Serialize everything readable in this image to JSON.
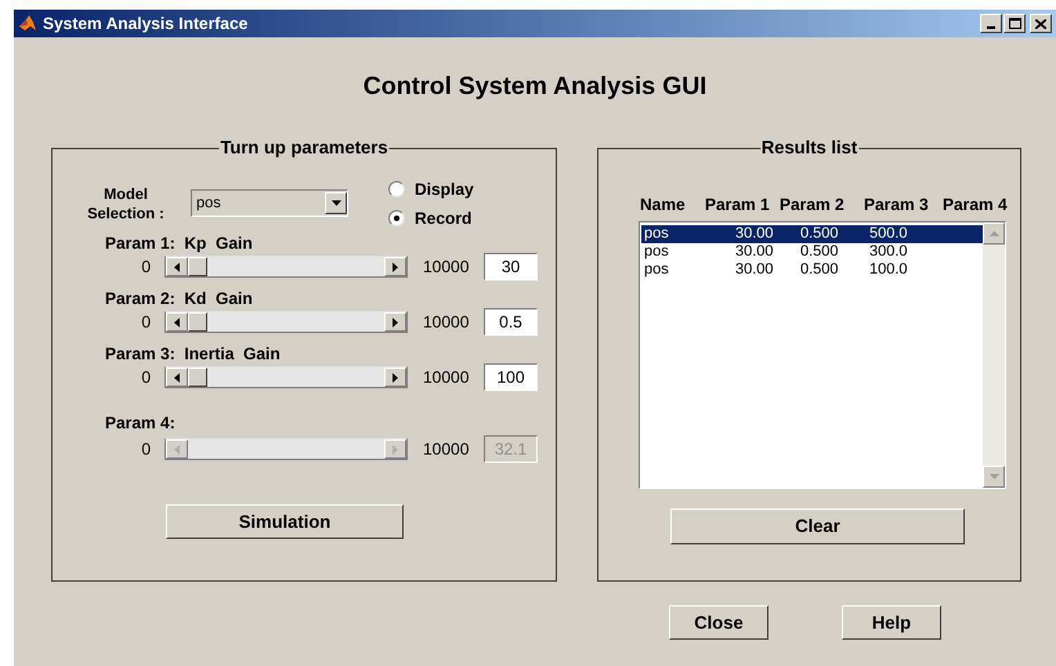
{
  "window": {
    "title": "System Analysis Interface"
  },
  "heading": "Control System Analysis GUI",
  "parameters_panel": {
    "title": "Turn up parameters",
    "model_label": "Model Selection :",
    "model_selection": {
      "value": "pos"
    },
    "modes": [
      {
        "label": "Display",
        "selected": false
      },
      {
        "label": "Record",
        "selected": true
      }
    ],
    "params": [
      {
        "label": "Param 1:  Kp  Gain",
        "min": "0",
        "max": "10000",
        "value": "30",
        "disabled": false
      },
      {
        "label": "Param 2:  Kd  Gain",
        "min": "0",
        "max": "10000",
        "value": "0.5",
        "disabled": false
      },
      {
        "label": "Param 3:  Inertia  Gain",
        "min": "0",
        "max": "10000",
        "value": "100",
        "disabled": false
      },
      {
        "label": "Param 4:",
        "min": "0",
        "max": "10000",
        "value": "32.1",
        "disabled": true
      }
    ],
    "simulate_button": "Simulation"
  },
  "results_panel": {
    "title": "Results list",
    "columns": [
      "Name",
      "Param 1",
      "Param 2",
      "Param 3",
      "Param 4"
    ],
    "rows": [
      {
        "cells": [
          "pos",
          "30.00",
          "0.500",
          "500.0"
        ],
        "selected": true
      },
      {
        "cells": [
          "pos",
          "30.00",
          "0.500",
          "300.0"
        ],
        "selected": false
      },
      {
        "cells": [
          "pos",
          "30.00",
          "0.500",
          "100.0"
        ],
        "selected": false
      }
    ],
    "clear_button": "Clear"
  },
  "buttons": [
    "Close",
    "Help"
  ]
}
